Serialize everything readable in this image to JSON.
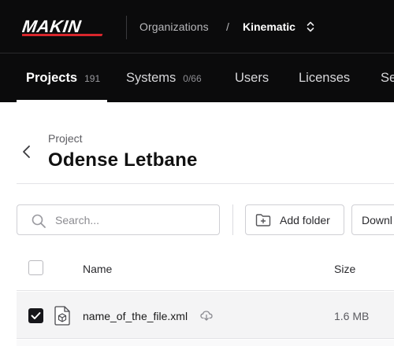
{
  "brand": {
    "logo_text": "MAKIN",
    "logo_color": "#ffffff",
    "logo_accent": "#d8262c"
  },
  "breadcrumb": {
    "org_label": "Organizations",
    "separator": "/",
    "current": "Kinematic",
    "current_icon": "chevron-up-down-icon"
  },
  "nav": {
    "tabs": [
      {
        "label": "Projects",
        "count": "191",
        "active": true
      },
      {
        "label": "Systems",
        "count": "0/66",
        "active": false
      },
      {
        "label": "Users",
        "count": "",
        "active": false
      },
      {
        "label": "Licenses",
        "count": "",
        "active": false
      },
      {
        "label": "Se",
        "count": "",
        "active": false
      }
    ]
  },
  "page": {
    "eyebrow": "Project",
    "title": "Odense Letbane",
    "back_icon": "chevron-left-icon"
  },
  "toolbar": {
    "search_placeholder": "Search...",
    "search_value": "",
    "add_folder_label": "Add folder",
    "download_label": "Downl"
  },
  "table": {
    "columns": {
      "name": "Name",
      "size": "Size"
    },
    "header_checked": false,
    "rows": [
      {
        "name": "name_of_the_file.xml",
        "size": "1.6 MB",
        "checked": true,
        "file_icon": "file-cube-icon",
        "status_icon": "cloud-download-icon"
      }
    ]
  },
  "colors": {
    "header_bg": "#0b0b0c",
    "selected_row_bg": "#f4f4f5",
    "checkbox_checked": "#16161a"
  }
}
